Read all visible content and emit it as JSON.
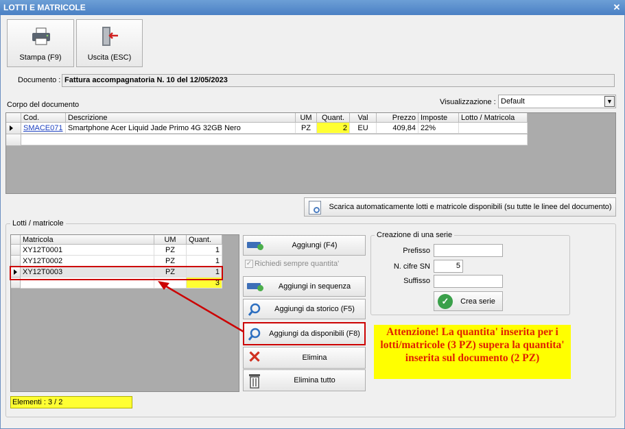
{
  "window": {
    "title": "LOTTI E MATRICOLE"
  },
  "toolbar": {
    "print_label": "Stampa (F9)",
    "exit_label": "Uscita (ESC)"
  },
  "documento": {
    "label": "Documento :",
    "value": "Fattura accompagnatoria N. 10 del 12/05/2023"
  },
  "corpo": {
    "label": "Corpo del documento"
  },
  "visualizzazione": {
    "label": "Visualizzazione :",
    "value": "Default"
  },
  "doc_table": {
    "headers": [
      "Cod.",
      "Descrizione",
      "UM",
      "Quant.",
      "Val",
      "Prezzo",
      "Imposte",
      "Lotto / Matricola"
    ],
    "row": {
      "cod": "SMACE071",
      "descrizione": "Smartphone Acer Liquid Jade Primo 4G 32GB Nero",
      "um": "PZ",
      "quant": "2",
      "val": "EU",
      "prezzo": "409,84",
      "imposte": "22%",
      "lotto": ""
    }
  },
  "scarica_button": "Scarica automaticamente lotti e matricole disponibili (su tutte le linee del documento)",
  "lotti": {
    "label": "Lotti / matricole",
    "headers": [
      "Matricola",
      "UM",
      "Quant."
    ],
    "rows": [
      {
        "matricola": "XY12T0001",
        "um": "PZ",
        "quant": "1"
      },
      {
        "matricola": "XY12T0002",
        "um": "PZ",
        "quant": "1"
      },
      {
        "matricola": "XY12T0003",
        "um": "PZ",
        "quant": "1"
      }
    ],
    "total": "3",
    "elementi": "Elementi : 3 / 2"
  },
  "actions": {
    "aggiungi": "Aggiungi (F4)",
    "richiedi": "Richiedi sempre quantita'",
    "sequenza": "Aggiungi in sequenza",
    "storico": "Aggiungi da storico (F5)",
    "disponibili": "Aggiungi da disponibili (F8)",
    "elimina": "Elimina",
    "elimina_tutto": "Elimina tutto"
  },
  "serie": {
    "label": "Creazione di una serie",
    "prefisso_label": "Prefisso",
    "prefisso_value": "",
    "cifre_label": "N. cifre SN",
    "cifre_value": "5",
    "suffisso_label": "Suffisso",
    "suffisso_value": "",
    "crea_label": "Crea serie"
  },
  "warning": "Attenzione! La quantita' inserita per i lotti/matricole (3 PZ) supera la quantita' inserita sul documento (2 PZ)",
  "colors": {
    "highlight_red": "#cc0000",
    "warning_text": "#e02000",
    "yellow": "#ffff33",
    "titlebar": "#4a80c4"
  }
}
